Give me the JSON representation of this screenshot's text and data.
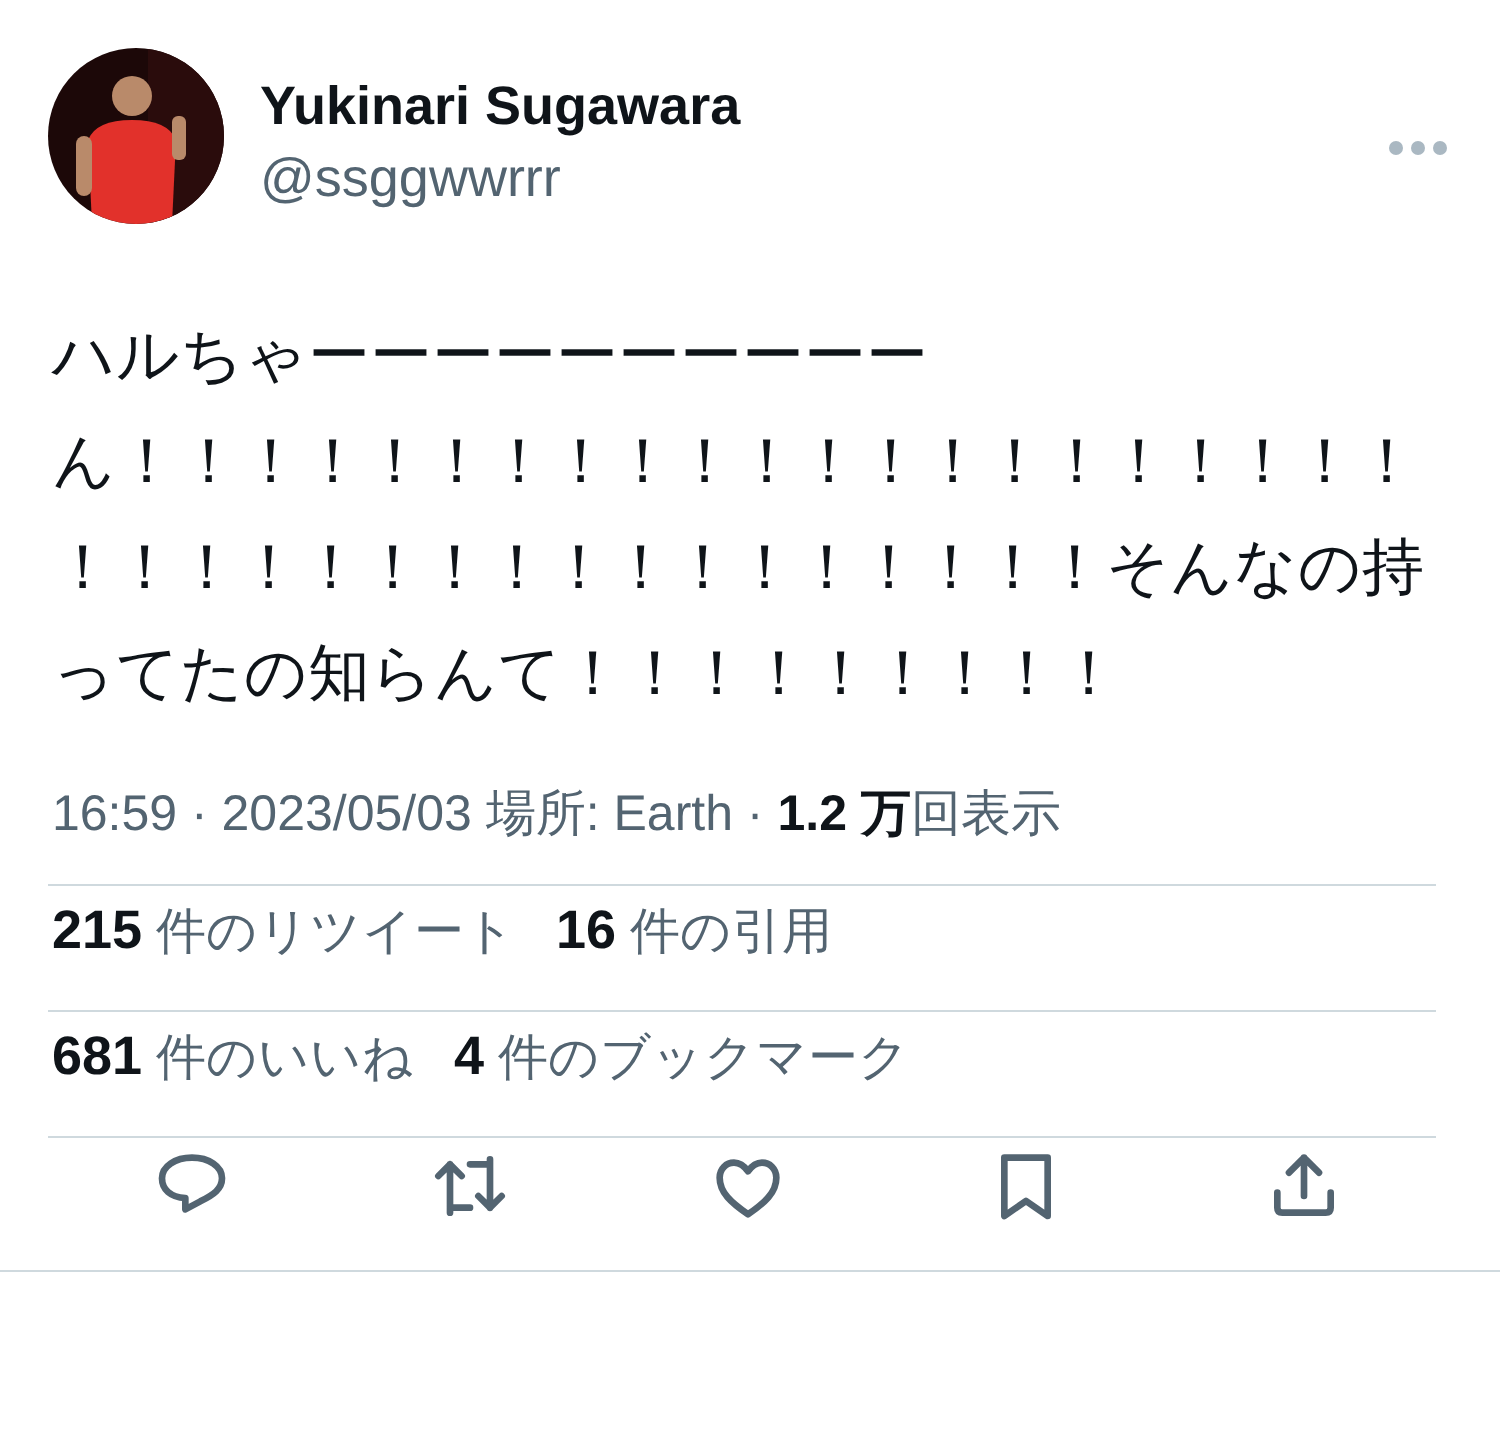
{
  "author": {
    "name": "Yukinari Sugawara",
    "handle": "@ssggwwrrr"
  },
  "more_menu": {
    "kind": "dots"
  },
  "text": [
    "ハルちゃーーーーーーーーーー",
    "ん！！！！！！！！！！！！！！！！！！！！！！！！！！！！！！！！！！！！！！そんなの持ってたの知らんて！！！！！！！！！"
  ],
  "meta": "16:59 · 2023/05/03 場所: Earth · **1.2 万**回表示",
  "stat_rows": [
    [
      {
        "count": "215",
        "label": "件のリツイート"
      },
      {
        "count": "16",
        "label": "件の引用"
      }
    ],
    [
      {
        "count": "681",
        "label": "件のいいね"
      },
      {
        "count": "4",
        "label": "件のブックマーク"
      }
    ]
  ],
  "actions": [
    {
      "kind": "reply"
    },
    {
      "kind": "retweet"
    },
    {
      "kind": "like"
    },
    {
      "kind": "bookmark"
    },
    {
      "kind": "share"
    }
  ]
}
